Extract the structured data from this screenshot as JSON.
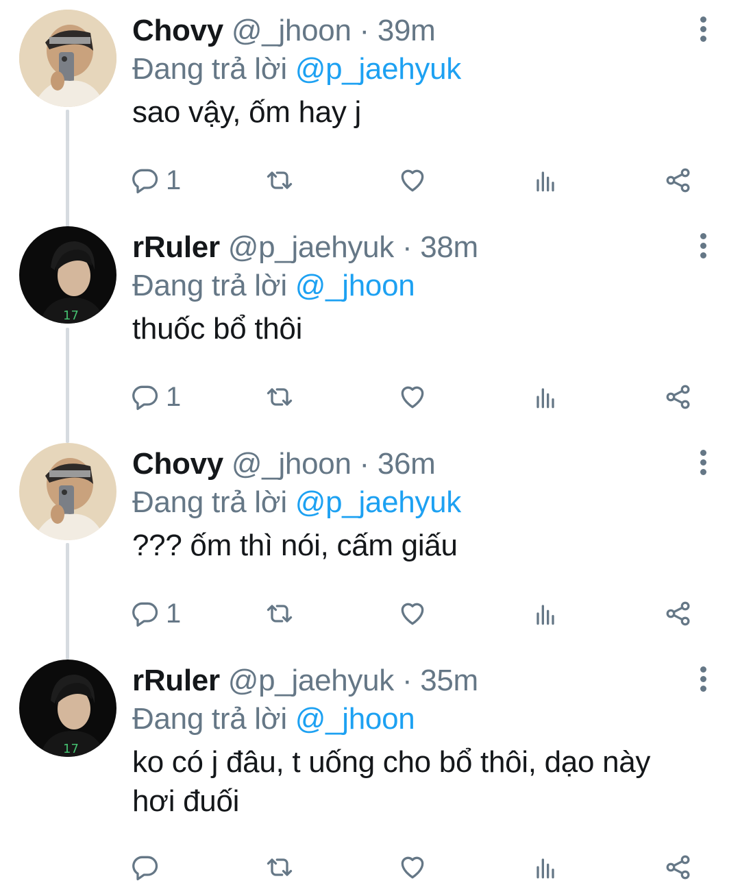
{
  "thread": {
    "reply_prefix": "Đang trả lời",
    "tweets": [
      {
        "name": "Chovy",
        "handle": "@_jhoon",
        "sep": " · ",
        "time": "39m",
        "reply_to": "@p_jaehyuk",
        "text": "sao vậy, ốm hay j",
        "reply_count": "1",
        "avatar": "chovy-avatar"
      },
      {
        "name": "rRuler",
        "handle": "@p_jaehyuk",
        "sep": " · ",
        "time": "38m",
        "reply_to": "@_jhoon",
        "text": "thuốc bổ thôi",
        "reply_count": "1",
        "avatar": "ruler-avatar"
      },
      {
        "name": "Chovy",
        "handle": "@_jhoon",
        "sep": " · ",
        "time": "36m",
        "reply_to": "@p_jaehyuk",
        "text": "??? ốm thì nói, cấm giấu",
        "reply_count": "1",
        "avatar": "chovy-avatar"
      },
      {
        "name": "rRuler",
        "handle": "@p_jaehyuk",
        "sep": " · ",
        "time": "35m",
        "reply_to": "@_jhoon",
        "text": "ko có j đâu, t uống cho bổ thôi, dạo này hơi đuối",
        "reply_count": "",
        "avatar": "ruler-avatar"
      }
    ]
  },
  "icons": [
    "reply-icon",
    "retweet-icon",
    "like-icon",
    "analytics-icon",
    "share-icon",
    "more-options-icon"
  ],
  "colors": {
    "text": "#14171a",
    "muted": "#657786",
    "mention": "#1da1f2",
    "thread_line": "#d6dbe0"
  }
}
